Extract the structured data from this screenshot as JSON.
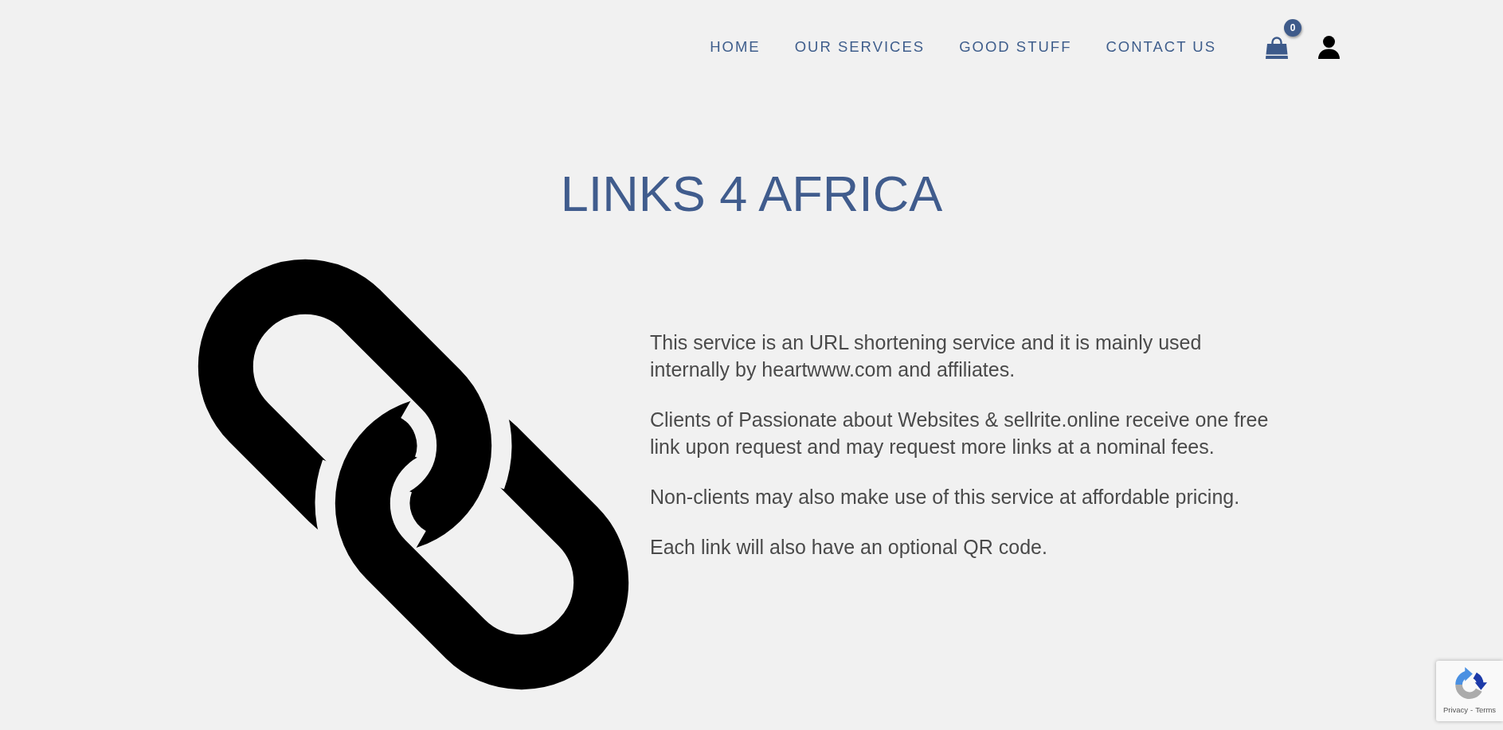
{
  "nav": {
    "links": [
      {
        "label": "HOME"
      },
      {
        "label": "OUR SERVICES"
      },
      {
        "label": "GOOD STUFF"
      },
      {
        "label": "CONTACT US"
      }
    ],
    "cart_count": "0"
  },
  "title": "LINKS 4 AFRICA",
  "paragraphs": [
    "This service is an URL shortening service and it is mainly used internally by heartwww.com and affiliates.",
    "Clients of Passionate about Websites & sellrite.online receive one free link upon request and may request more links at a nominal fees.",
    "Non-clients may also make use of this service at affordable pricing.",
    "Each link will also have an optional QR code."
  ],
  "recaptcha": {
    "privacy": "Privacy",
    "separator": "-",
    "terms": "Terms"
  }
}
